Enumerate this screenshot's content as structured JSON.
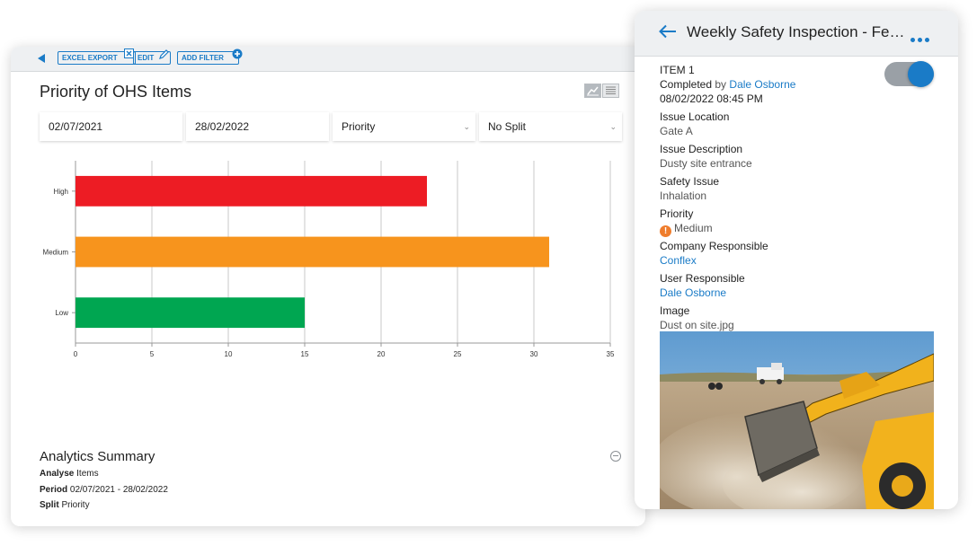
{
  "toolbar": {
    "excel_export": "EXCEL EXPORT",
    "edit": "EDIT",
    "add_filter": "ADD FILTER"
  },
  "report": {
    "title": "Priority of OHS Items",
    "filters": {
      "start_date": "02/07/2021",
      "end_date": "28/02/2022",
      "group_by": "Priority",
      "split": "No Split"
    }
  },
  "chart_data": {
    "type": "bar",
    "orientation": "horizontal",
    "categories": [
      "High",
      "Medium",
      "Low"
    ],
    "values": [
      23,
      31,
      15
    ],
    "colors": [
      "#ed1c24",
      "#f7941d",
      "#00a651"
    ],
    "xlim": [
      0,
      35
    ],
    "xticks": [
      0,
      5,
      10,
      15,
      20,
      25,
      30,
      35
    ],
    "grid": true,
    "title": "",
    "xlabel": "",
    "ylabel": ""
  },
  "summary": {
    "title": "Analytics Summary",
    "analyse_label": "Analyse",
    "analyse_value": "Items",
    "period_label": "Period",
    "period_value": "02/07/2021 - 28/02/2022",
    "split_label": "Split",
    "split_value": "Priority"
  },
  "detail": {
    "title": "Weekly Safety Inspection - Febr...",
    "item_label": "ITEM 1",
    "completed_label": "Completed",
    "by": "by",
    "completed_by": "Dale Osborne",
    "completed_at": "08/02/2022 08:45 PM",
    "toggle_on": true,
    "fields": {
      "issue_location_label": "Issue Location",
      "issue_location": "Gate A",
      "issue_description_label": "Issue Description",
      "issue_description": "Dusty site entrance",
      "safety_issue_label": "Safety Issue",
      "safety_issue": "Inhalation",
      "priority_label": "Priority",
      "priority": "Medium",
      "company_label": "Company Responsible",
      "company": "Conflex",
      "user_label": "User Responsible",
      "user": "Dale Osborne",
      "image_label": "Image",
      "image_name": "Dust on site.jpg"
    }
  },
  "colors": {
    "accent": "#1a7bc7",
    "warning": "#ef7d2d"
  }
}
